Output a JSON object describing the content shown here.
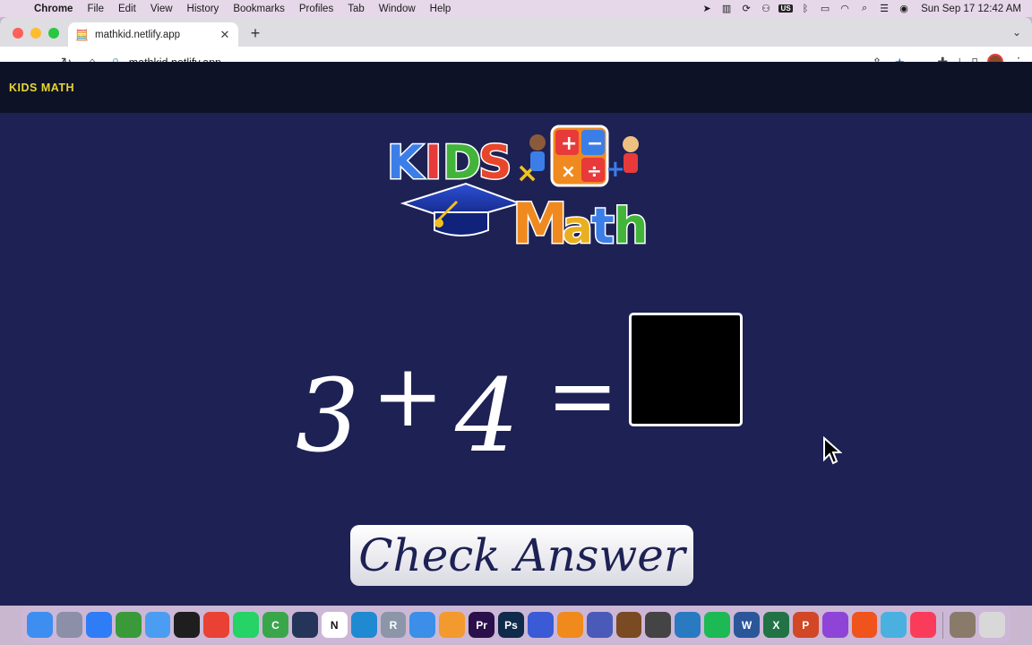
{
  "menubar": {
    "app_name": "Chrome",
    "items": [
      "File",
      "Edit",
      "View",
      "History",
      "Bookmarks",
      "Profiles",
      "Tab",
      "Window",
      "Help"
    ],
    "status_icons": [
      "location-icon",
      "sidebar-icon",
      "sync-icon",
      "accessibility-icon",
      "input-source-icon",
      "bluetooth-icon",
      "battery-icon",
      "wifi-icon",
      "spotlight-icon",
      "control-center-icon",
      "siri-icon"
    ],
    "input_source": "US",
    "clock": "Sun Sep 17  12:42 AM"
  },
  "browser": {
    "tab_title": "mathkid.netlify.app",
    "url": "mathkid.netlify.app",
    "colors": {
      "tab_bg": "#ffffff",
      "star": "#1a73e8"
    }
  },
  "page": {
    "brand": "KIDS MATH",
    "logo_word_1": "KIDS",
    "logo_word_2": "Math",
    "equation": {
      "a": "3",
      "op": "+",
      "b": "4",
      "eq": "="
    },
    "answer_value": "",
    "check_button_label": "Check Answer",
    "colors": {
      "background": "#1d2154",
      "navbar": "#0e1226",
      "brand": "#e6d633"
    }
  },
  "dock": {
    "apps": [
      {
        "name": "finder-icon",
        "label": "",
        "color": "#3d8ef0"
      },
      {
        "name": "launchpad-icon",
        "label": "",
        "color": "#8b8fa8"
      },
      {
        "name": "safari-icon",
        "label": "",
        "color": "#2f7df6"
      },
      {
        "name": "activity-ring-icon",
        "label": "",
        "color": "#3a9a3a"
      },
      {
        "name": "mail-icon",
        "label": "",
        "color": "#4a9df3"
      },
      {
        "name": "figma-icon",
        "label": "",
        "color": "#1e1e1e"
      },
      {
        "name": "chrome-icon",
        "label": "",
        "color": "#e94235"
      },
      {
        "name": "whatsapp-icon",
        "label": "",
        "color": "#25d366"
      },
      {
        "name": "camtasia-icon",
        "label": "C",
        "color": "#3aa64c"
      },
      {
        "name": "bird-app-icon",
        "label": "",
        "color": "#25355a"
      },
      {
        "name": "notion-icon",
        "label": "N",
        "color": "#ffffff"
      },
      {
        "name": "vscode-icon",
        "label": "",
        "color": "#1f8ad2"
      },
      {
        "name": "r-lang-icon",
        "label": "R",
        "color": "#8b96a8"
      },
      {
        "name": "keynote-icon",
        "label": "",
        "color": "#3b8fe8"
      },
      {
        "name": "books-icon",
        "label": "",
        "color": "#f29a2e"
      },
      {
        "name": "premiere-icon",
        "label": "Pr",
        "color": "#2a0f4a"
      },
      {
        "name": "photoshop-icon",
        "label": "Ps",
        "color": "#0f2a4a"
      },
      {
        "name": "infuse-icon",
        "label": "",
        "color": "#3a5ad6"
      },
      {
        "name": "vlc-icon",
        "label": "",
        "color": "#f08a1c"
      },
      {
        "name": "headset-app-icon",
        "label": "",
        "color": "#4a5ab8"
      },
      {
        "name": "wood-circle-icon",
        "label": "",
        "color": "#7a4a22"
      },
      {
        "name": "chess-icon",
        "label": "",
        "color": "#444444"
      },
      {
        "name": "proxyman-icon",
        "label": "",
        "color": "#2a7ac2"
      },
      {
        "name": "spotify-icon",
        "label": "",
        "color": "#1db954"
      },
      {
        "name": "word-icon",
        "label": "W",
        "color": "#2b579a"
      },
      {
        "name": "excel-icon",
        "label": "X",
        "color": "#217346"
      },
      {
        "name": "powerpoint-icon",
        "label": "P",
        "color": "#d24726"
      },
      {
        "name": "podcasts-icon",
        "label": "",
        "color": "#8e44d6"
      },
      {
        "name": "brave-icon",
        "label": "",
        "color": "#f0531c"
      },
      {
        "name": "preview-icon",
        "label": "",
        "color": "#4ab0e0"
      },
      {
        "name": "music-icon",
        "label": "",
        "color": "#fa3c5a"
      }
    ],
    "trailing": [
      {
        "name": "downloads-stack-icon",
        "label": "",
        "color": "#8a7a6a"
      },
      {
        "name": "trash-icon",
        "label": "",
        "color": "#d8d8d8"
      }
    ]
  }
}
